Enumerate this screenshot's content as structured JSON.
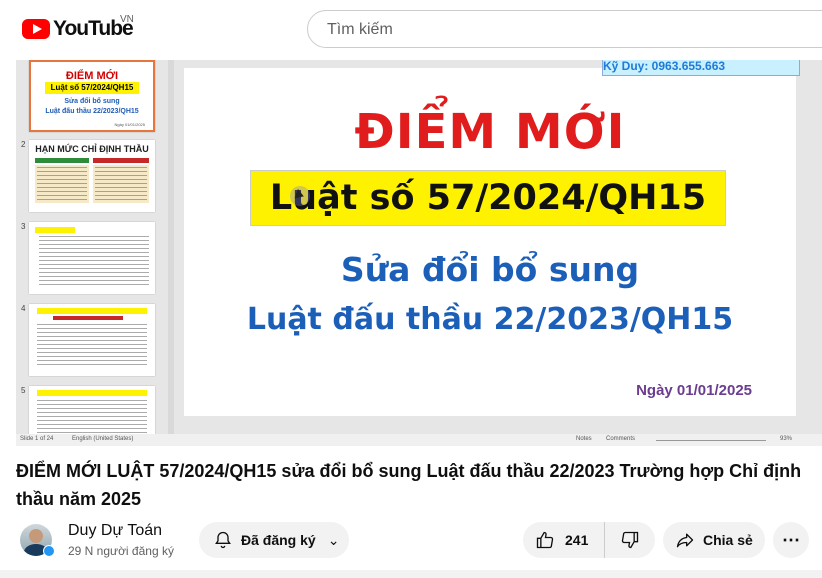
{
  "header": {
    "logo_text": "YouTube",
    "region": "VN",
    "search_placeholder": "Tìm kiếm"
  },
  "slides": {
    "numbers": [
      "2",
      "3",
      "4",
      "5"
    ],
    "thumb1": {
      "title": "ĐIỂM MỚI",
      "law": "Luật số 57/2024/QH15",
      "line1": "Sửa đổi bổ sung",
      "line2": "Luật đấu thầu 22/2023/QH15",
      "date": "Ngày 01/01/2025"
    },
    "thumb2_title": "HẠN MỨC CHỈ ĐỊNH THẦU",
    "current": {
      "top_band": "Kỹ Duy: 0963.655.663",
      "title": "ĐIỂM MỚI",
      "law": "Luật số 57/2024/QH15",
      "line1": "Sửa đổi bổ sung",
      "line2": "Luật đấu thầu 22/2023/QH15",
      "date": "Ngày 01/01/2025"
    },
    "status": {
      "slide_count": "Slide 1 of 24",
      "language": "English (United States)",
      "notes": "Notes",
      "comments": "Comments",
      "zoom": "93%"
    }
  },
  "video": {
    "title": "ĐIỂM MỚI LUẬT 57/2024/QH15 sửa đổi bổ sung Luật đấu thầu 22/2023 Trường hợp Chỉ định thầu năm 2025",
    "channel": "Duy Dự Toán",
    "subscribers": "29 N người đăng ký",
    "subscribe_label": "Đã đăng ký",
    "likes": "241",
    "share_label": "Chia sẻ",
    "more_label": "⋯"
  }
}
